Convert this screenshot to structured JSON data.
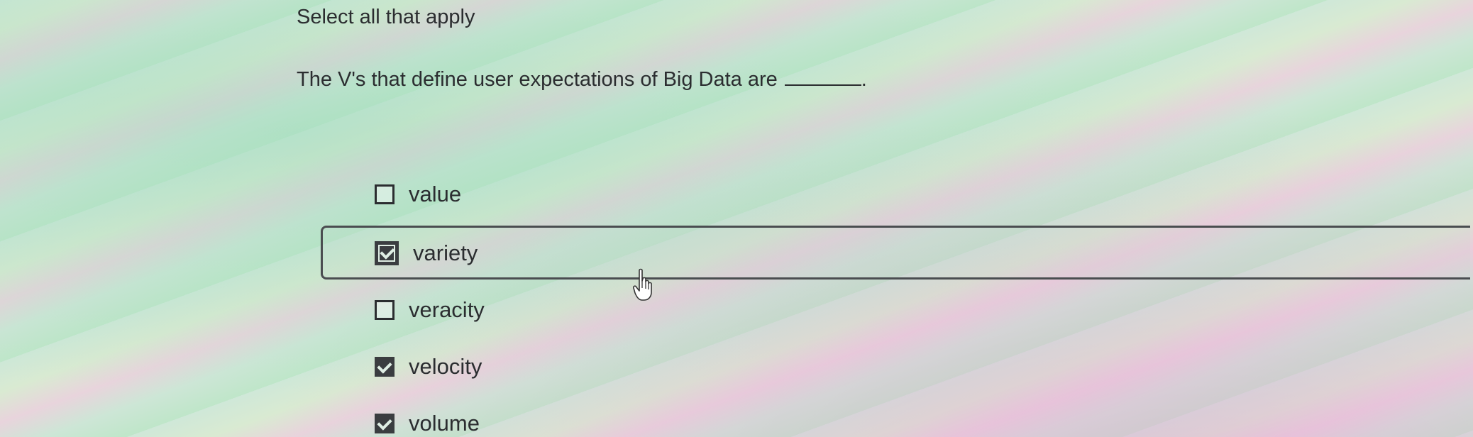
{
  "prompt": "Select all that apply",
  "question": "The V's that define user expectations of Big Data are",
  "question_end": ".",
  "options": [
    {
      "label": "value",
      "checked": false
    },
    {
      "label": "variety",
      "checked": true
    },
    {
      "label": "veracity",
      "checked": false
    },
    {
      "label": "velocity",
      "checked": true
    },
    {
      "label": "volume",
      "checked": true
    }
  ],
  "icons": {
    "cursor": "hand-pointer-icon",
    "checkbox": "checkbox-icon"
  }
}
